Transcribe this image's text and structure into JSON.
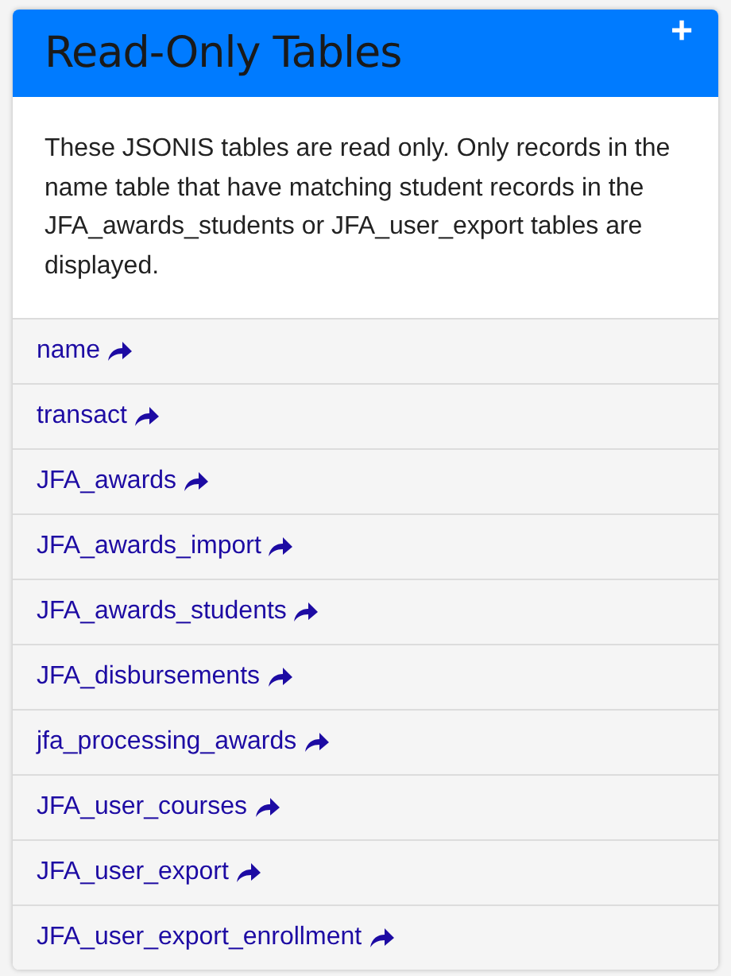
{
  "panel": {
    "title": "Read-Only Tables",
    "add_icon": "+",
    "description": "These JSONIS tables are read only. Only records in the name table that have matching student records in the JFA_awards_students or JFA_user_export tables are displayed.",
    "tables": [
      {
        "label": "name"
      },
      {
        "label": "transact"
      },
      {
        "label": "JFA_awards"
      },
      {
        "label": "JFA_awards_import"
      },
      {
        "label": "JFA_awards_students"
      },
      {
        "label": "JFA_disbursements"
      },
      {
        "label": "jfa_processing_awards"
      },
      {
        "label": "JFA_user_courses"
      },
      {
        "label": "JFA_user_export"
      },
      {
        "label": "JFA_user_export_enrollment"
      }
    ]
  }
}
